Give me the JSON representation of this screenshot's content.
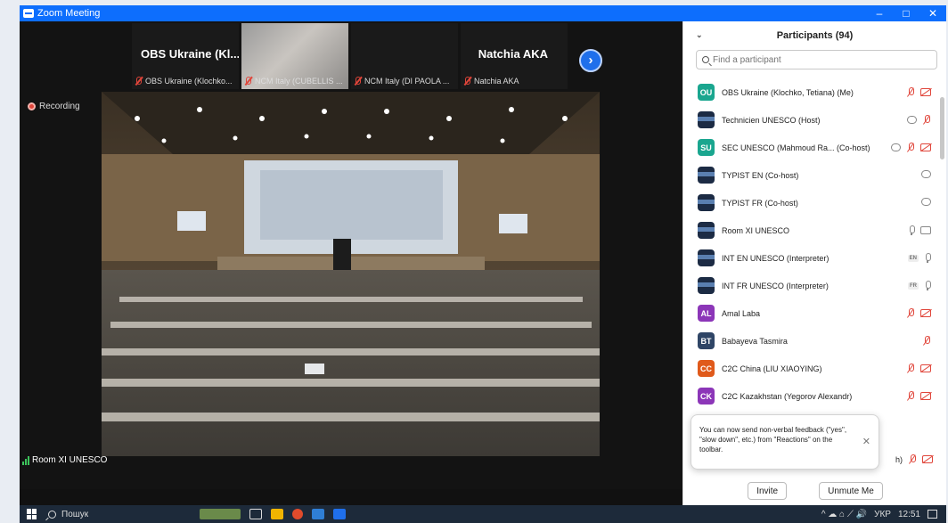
{
  "window": {
    "title": "Zoom Meeting",
    "minimize_glyph": "–",
    "maximize_glyph": "□",
    "close_glyph": "✕"
  },
  "gallery": [
    {
      "name": "OBS Ukraine (Kl...",
      "label": "OBS Ukraine (Klochko..."
    },
    {
      "name": "",
      "label": "NCM Italy (CUBELLIS ..."
    },
    {
      "name": "",
      "label": "NCM Italy (DI PAOLA ..."
    },
    {
      "name": "Natchia AKA",
      "label": "Natchia AKA"
    }
  ],
  "next_glyph": "›",
  "recording_label": "Recording",
  "speaker_label": "Room XI UNESCO",
  "panel": {
    "title": "Participants (94)",
    "collapse_glyph": "⌄",
    "search_placeholder": "Find a participant",
    "invite_label": "Invite",
    "unmute_label": "Unmute Me",
    "toast": "You can now send non-verbal feedback (\"yes\", \"slow down\", etc.) from \"Reactions\" on the toolbar.",
    "toast_close": "✕",
    "row_tail_text": "h)"
  },
  "participants": [
    {
      "initials": "OU",
      "color": "#1aa68f",
      "name": "OBS Ukraine (Klochko, Tetiana) (Me)",
      "icons": [
        "mic-off",
        "cam-off"
      ]
    },
    {
      "initials": "",
      "color": "device",
      "name": "Technicien UNESCO (Host)",
      "icons": [
        "cloud",
        "mic-off"
      ]
    },
    {
      "initials": "SU",
      "color": "#1aa68f",
      "name": "SEC UNESCO (Mahmoud Ra... (Co-host)",
      "icons": [
        "cloud",
        "mic-off",
        "cam-off"
      ]
    },
    {
      "initials": "",
      "color": "device",
      "name": "TYPIST EN (Co-host)",
      "icons": [
        "cloud"
      ]
    },
    {
      "initials": "",
      "color": "device",
      "name": "TYPIST FR (Co-host)",
      "icons": [
        "cloud"
      ]
    },
    {
      "initials": "",
      "color": "device",
      "name": "Room XI UNESCO",
      "icons": [
        "mic",
        "cam"
      ]
    },
    {
      "initials": "",
      "color": "device",
      "name": "INT EN UNESCO (Interpreter)",
      "lang": "EN",
      "icons": [
        "mic"
      ]
    },
    {
      "initials": "",
      "color": "device",
      "name": "INT FR UNESCO (Interpreter)",
      "lang": "FR",
      "icons": [
        "mic"
      ]
    },
    {
      "initials": "AL",
      "color": "#8c36b8",
      "name": "Amal Laba",
      "icons": [
        "mic-off",
        "cam-off"
      ]
    },
    {
      "initials": "BT",
      "color": "#2f4566",
      "name": "Babayeva Tasmira",
      "icons": [
        "mic-off"
      ]
    },
    {
      "initials": "CC",
      "color": "#e05a1b",
      "name": "C2C China (LIU XIAOYING)",
      "icons": [
        "mic-off",
        "cam-off"
      ]
    },
    {
      "initials": "CK",
      "color": "#8c36b8",
      "name": "C2C Kazakhstan (Yegorov Alexandr)",
      "icons": [
        "mic-off",
        "cam-off"
      ]
    }
  ],
  "taskbar": {
    "search_text": "Пошук",
    "lang": "УКР",
    "time": "12:51",
    "tray_glyphs": "^ ☁ ⌂ ⟋ 🔊"
  }
}
